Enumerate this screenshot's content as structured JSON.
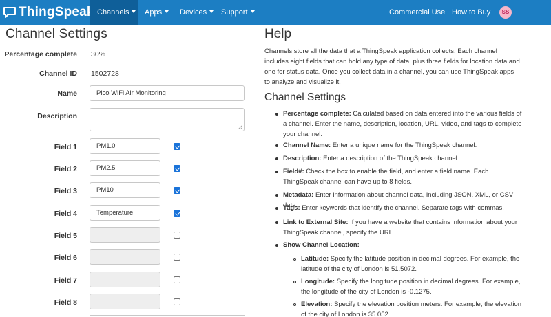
{
  "navbar": {
    "brand": "ThingSpeak",
    "brand_tm": "™",
    "items": [
      {
        "label": "Channels"
      },
      {
        "label": "Apps"
      },
      {
        "label": "Devices"
      },
      {
        "label": "Support"
      }
    ],
    "right_items": [
      {
        "label": "Commercial Use"
      },
      {
        "label": "How to Buy"
      }
    ],
    "avatar_initials": "SS",
    "colors": {
      "bar": "#1c7ec3",
      "active": "#0f5f99",
      "avatar_bg": "#f7b6c9"
    }
  },
  "settings": {
    "title": "Channel Settings",
    "percentage_label": "Percentage complete",
    "percentage_value": "30%",
    "channel_id_label": "Channel ID",
    "channel_id_value": "1502728",
    "name_label": "Name",
    "name_value": "Pico WiFi Air Monitoring",
    "description_label": "Description",
    "description_value": "",
    "fields": [
      {
        "label": "Field 1",
        "value": "PM1.0",
        "checked": true
      },
      {
        "label": "Field 2",
        "value": "PM2.5",
        "checked": true
      },
      {
        "label": "Field 3",
        "value": "PM10",
        "checked": true
      },
      {
        "label": "Field 4",
        "value": "Temperature",
        "checked": true
      },
      {
        "label": "Field 5",
        "value": "",
        "checked": false
      },
      {
        "label": "Field 6",
        "value": "",
        "checked": false
      },
      {
        "label": "Field 7",
        "value": "",
        "checked": false
      },
      {
        "label": "Field 8",
        "value": "",
        "checked": false
      }
    ]
  },
  "help": {
    "title": "Help",
    "intro": "Channels store all the data that a ThingSpeak application collects. Each channel includes eight fields that can hold any type of data, plus three fields for location data and one for status data. Once you collect data in a channel, you can use ThingSpeak apps to analyze and visualize it.",
    "subtitle": "Channel Settings",
    "items": [
      {
        "term": "Percentage complete:",
        "text": " Calculated based on data entered into the various fields of a channel. Enter the name, description, location, URL, video, and tags to complete your channel."
      },
      {
        "term": "Channel Name:",
        "text": " Enter a unique name for the ThingSpeak channel."
      },
      {
        "term": "Description:",
        "text": " Enter a description of the ThingSpeak channel."
      },
      {
        "term": "Field#:",
        "text": " Check the box to enable the field, and enter a field name. Each ThingSpeak channel can have up to 8 fields."
      },
      {
        "term": "Metadata:",
        "text": " Enter information about channel data, including JSON, XML, or CSV data."
      },
      {
        "term": "Tags:",
        "text": " Enter keywords that identify the channel. Separate tags with commas."
      },
      {
        "term": "Link to External Site:",
        "text": " If you have a website that contains information about your ThingSpeak channel, specify the URL."
      },
      {
        "term": "Show Channel Location:",
        "text": ""
      }
    ],
    "sub_items": [
      {
        "term": "Latitude:",
        "text": " Specify the latitude position in decimal degrees. For example, the latitude of the city of London is 51.5072."
      },
      {
        "term": "Longitude:",
        "text": " Specify the longitude position in decimal degrees. For example, the longitude of the city of London is -0.1275."
      },
      {
        "term": "Elevation:",
        "text": " Specify the elevation position meters. For example, the elevation of the city of London is 35.052."
      }
    ]
  }
}
